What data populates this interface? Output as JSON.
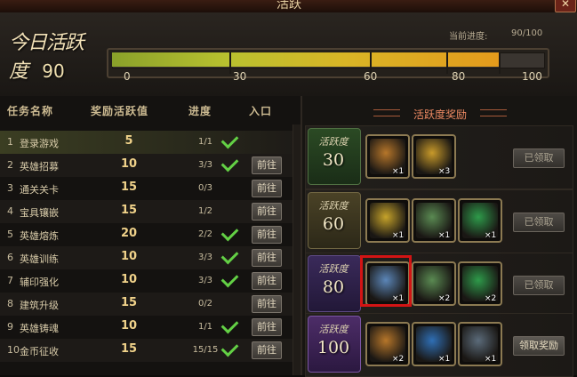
{
  "window": {
    "title": "活跃",
    "close_label": "✕"
  },
  "header": {
    "today_title": "今日活跃度",
    "today_value": "90",
    "progress_label": "当前进度:",
    "progress_value": "90/100",
    "progress_fraction": 0.9,
    "ticks": [
      "0",
      "30",
      "60",
      "80",
      "100"
    ]
  },
  "table": {
    "headers": {
      "name": "任务名称",
      "reward": "奖励活跃值",
      "progress": "进度",
      "entry": "入口"
    },
    "go_label": "前往",
    "rows": [
      {
        "num": "1",
        "name": "登录游戏",
        "value": "5",
        "progress": "1/1",
        "done": true,
        "go": false
      },
      {
        "num": "2",
        "name": "英雄招募",
        "value": "10",
        "progress": "3/3",
        "done": true,
        "go": true
      },
      {
        "num": "3",
        "name": "通关关卡",
        "value": "15",
        "progress": "0/3",
        "done": false,
        "go": true
      },
      {
        "num": "4",
        "name": "宝具镶嵌",
        "value": "15",
        "progress": "1/2",
        "done": false,
        "go": true
      },
      {
        "num": "5",
        "name": "英雄熔炼",
        "value": "20",
        "progress": "2/2",
        "done": true,
        "go": true
      },
      {
        "num": "6",
        "name": "英雄训练",
        "value": "10",
        "progress": "3/3",
        "done": true,
        "go": true
      },
      {
        "num": "7",
        "name": "辅印强化",
        "value": "10",
        "progress": "3/3",
        "done": true,
        "go": true
      },
      {
        "num": "8",
        "name": "建筑升级",
        "value": "15",
        "progress": "0/2",
        "done": false,
        "go": true
      },
      {
        "num": "9",
        "name": "英雄铸魂",
        "value": "10",
        "progress": "1/1",
        "done": true,
        "go": true
      },
      {
        "num": "10",
        "name": "金币征收",
        "value": "15",
        "progress": "15/15",
        "done": true,
        "go": true
      }
    ]
  },
  "rewards": {
    "title": "活跃度奖励",
    "badge_label": "活跃度",
    "tiers": [
      {
        "level": "30",
        "button": "已领取",
        "items": [
          {
            "icon": "hourglass-icon",
            "qty": "×1",
            "color": "#b6762a"
          },
          {
            "icon": "campaign-token-icon",
            "qty": "×3",
            "color": "#c89a2a"
          }
        ]
      },
      {
        "level": "60",
        "button": "已领取",
        "items": [
          {
            "icon": "horn-icon",
            "qty": "×1",
            "color": "#c6a32a"
          },
          {
            "icon": "beginner-scroll-icon",
            "qty": "×1",
            "color": "#5a8a52"
          },
          {
            "icon": "green-talisman-icon",
            "qty": "×1",
            "color": "#2e9a4a"
          }
        ]
      },
      {
        "level": "80",
        "button": "已领取",
        "items": [
          {
            "icon": "potion-jar-icon",
            "qty": "×1",
            "color": "#5b86b8"
          },
          {
            "icon": "beginner-scroll-icon",
            "qty": "×2",
            "color": "#5a8a52"
          },
          {
            "icon": "green-talisman-icon",
            "qty": "×2",
            "color": "#2e9a4a"
          }
        ]
      },
      {
        "level": "100",
        "button": "领取奖励",
        "items": [
          {
            "icon": "hourglass-icon",
            "qty": "×2",
            "color": "#b6762a"
          },
          {
            "icon": "blue-talisman-icon",
            "qty": "×1",
            "color": "#2f6fb5"
          },
          {
            "icon": "gray-talisman-icon",
            "qty": "×1",
            "color": "#5b6b7a"
          }
        ]
      }
    ]
  }
}
